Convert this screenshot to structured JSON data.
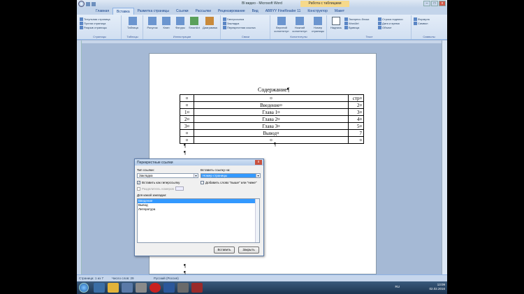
{
  "window": {
    "title": "Bl видео - Microsoft Word",
    "context_tab": "Работа с таблицами"
  },
  "tabs": [
    "Главная",
    "Вставка",
    "Разметка страницы",
    "Ссылки",
    "Рассылки",
    "Рецензирование",
    "Вид",
    "ABBYY FineReader 11",
    "Конструктор",
    "Макет"
  ],
  "ribbon": {
    "pages_items": [
      "Титульная страница",
      "Пустая страница",
      "Разрыв страницы"
    ],
    "table_label": "Таблица",
    "illus": [
      "Рисунок",
      "Клип",
      "Фигуры",
      "SmartArt",
      "Диаграмма"
    ],
    "links_items": [
      "Гиперссылка",
      "Закладка",
      "Перекрестная ссылка"
    ],
    "header_items": [
      "Верхний колонтитул",
      "Нижний колонтитул",
      "Номер страницы"
    ],
    "text_items": [
      "Надпись",
      "Экспресс-блоки",
      "WordArt",
      "Буквица"
    ],
    "text_right": [
      "Строка подписи",
      "Дата и время",
      "Объект"
    ],
    "symbols": [
      "Формула",
      "Символ"
    ],
    "groups": [
      "Страницы",
      "Таблицы",
      "Иллюстрации",
      "Связи",
      "Колонтитулы",
      "Текст",
      "Символы"
    ]
  },
  "document": {
    "toc_title": "Содержание¶",
    "rows": [
      {
        "num": "¤",
        "name": "¤",
        "page": "стр¤"
      },
      {
        "num": "¤",
        "name": "Введение¤",
        "page": "2¤"
      },
      {
        "num": "1¤",
        "name": "Глава 1¤",
        "page": "3¤"
      },
      {
        "num": "2¤",
        "name": "Глава 2¤",
        "page": "4¤"
      },
      {
        "num": "3¤",
        "name": "Глава 3¤",
        "page": "5¤"
      },
      {
        "num": "¤",
        "name": "Вывод¤",
        "page": "7"
      },
      {
        "num": "¤",
        "name": "¤",
        "page": "¤"
      }
    ],
    "pilcrow": "¶"
  },
  "dialog": {
    "title": "Перекрестные ссылки",
    "close": "x",
    "type_label": "Тип ссылки:",
    "type_value": "Закладка",
    "insert_label": "Вставить ссылку на:",
    "insert_value": "Номер страницы",
    "hyperlink_check": "Вставить как гиперссылку",
    "above_below_check": "Добавить слово \"выше\" или \"ниже\"",
    "separator_label": "Разделитель номеров",
    "for_which_label": "Для какой закладки:",
    "bookmarks": [
      "Введение",
      "Вывод",
      "Литература"
    ],
    "insert_btn": "Вставить",
    "cancel_btn": "Закрыть"
  },
  "status": {
    "page": "Страница: 1 из 7",
    "words": "Число слов: 29",
    "lang": "Русский (Россия)"
  },
  "taskbar": {
    "lang": "RU",
    "time": "13:09",
    "date": "02.02.2016"
  }
}
